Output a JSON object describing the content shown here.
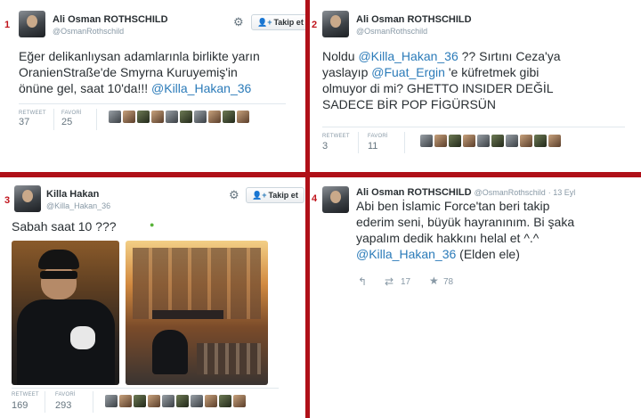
{
  "panels": [
    {
      "number": "1",
      "name": "Ali Osman ROTHSCHILD",
      "handle": "@OsmanRothschild",
      "follow_label": "Takip et",
      "text_lines": [
        [
          {
            "t": "Eğer delikanlıysan adamlarınla birlikte yarın"
          }
        ],
        [
          {
            "t": "OranienStraße'de Smyrna Kuruyemiş'in"
          }
        ],
        [
          {
            "t": "önüne gel, saat 10'da!!! "
          },
          {
            "t": "@Killa_Hakan_36",
            "mention": true
          }
        ]
      ],
      "retweet_label": "RETWEET",
      "retweet_count": "37",
      "favorite_label": "FAVORİ",
      "favorite_count": "25"
    },
    {
      "number": "2",
      "name": "Ali Osman ROTHSCHILD",
      "handle": "@OsmanRothschild",
      "text_lines": [
        [
          {
            "t": "Noldu "
          },
          {
            "t": "@Killa_Hakan_36",
            "mention": true
          },
          {
            "t": " ?? Sırtını Ceza'ya"
          }
        ],
        [
          {
            "t": "yaslayıp "
          },
          {
            "t": "@Fuat_Ergin",
            "mention": true
          },
          {
            "t": " 'e küfretmek gibi"
          }
        ],
        [
          {
            "t": "olmuyor di mi? GHETTO INSIDER DEĞİL"
          }
        ],
        [
          {
            "t": "SADECE BİR POP FİGÜRSÜN"
          }
        ]
      ],
      "retweet_label": "RETWEET",
      "retweet_count": "3",
      "favorite_label": "FAVORİ",
      "favorite_count": "11"
    },
    {
      "number": "3",
      "name": "Killa Hakan",
      "handle": "@Killa_Hakan_36",
      "follow_label": "Takip et",
      "text_lines": [
        [
          {
            "t": "Sabah saat  10  ???"
          }
        ]
      ],
      "retweet_label": "RETWEET",
      "retweet_count": "169",
      "favorite_label": "FAVORİ",
      "favorite_count": "293"
    },
    {
      "number": "4",
      "name": "Ali Osman ROTHSCHILD",
      "handle": "@OsmanRothschild",
      "date": "· 13 Eyl",
      "text_lines": [
        [
          {
            "t": "Abi ben İslamic Force'tan beri takip"
          }
        ],
        [
          {
            "t": "ederim seni, büyük hayranınım. Bi şaka"
          }
        ],
        [
          {
            "t": "yapalım dedik hakkını helal et ^.^"
          }
        ],
        [
          {
            "t": "@Killa_Hakan_36",
            "mention": true
          },
          {
            "t": " (Elden ele)"
          }
        ]
      ],
      "reply_icon": "reply-icon",
      "retweet_icon": "retweet-icon",
      "retweet_count": "17",
      "favorite_icon": "star-icon",
      "favorite_count": "78"
    }
  ],
  "colors": {
    "divider": "#b01018",
    "mention": "#2b7bb9",
    "number": "#c0141c"
  }
}
